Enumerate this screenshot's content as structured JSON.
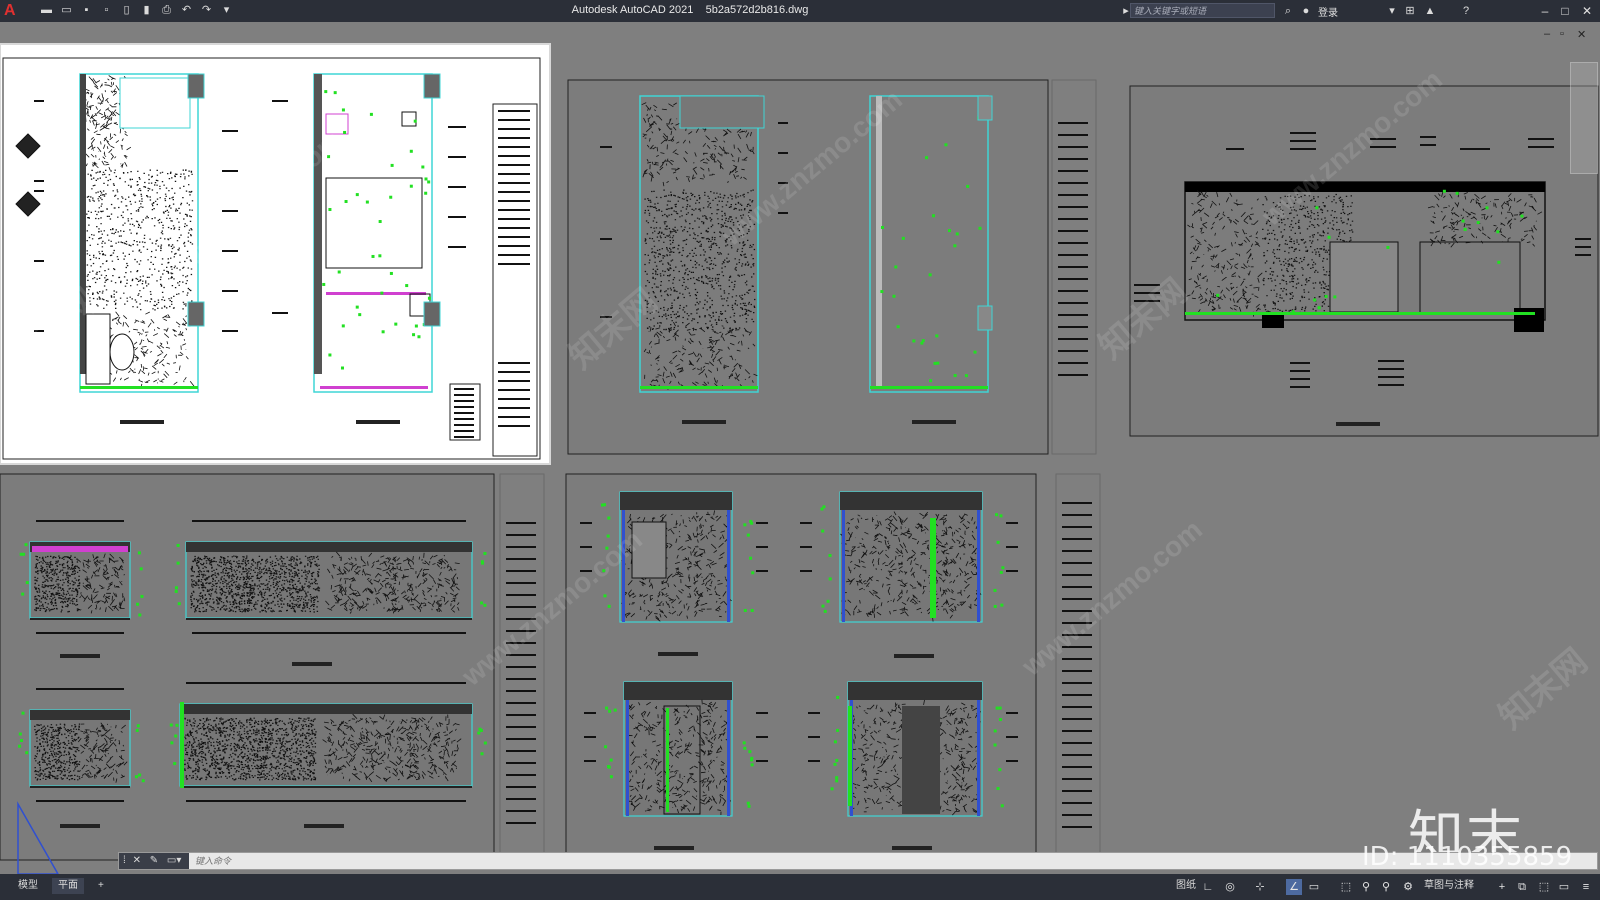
{
  "titlebar": {
    "app_name": "Autodesk AutoCAD 2021",
    "file_name": "5b2a572d2b816.dwg",
    "search_placeholder": "键入关键字或短语",
    "login_label": "登录",
    "app_logo": "A"
  },
  "quick_access": [
    {
      "icon": "new-icon",
      "glyph": "▬"
    },
    {
      "icon": "open-icon",
      "glyph": "▭"
    },
    {
      "icon": "save-icon",
      "glyph": "▪"
    },
    {
      "icon": "save-as-icon",
      "glyph": "▫"
    },
    {
      "icon": "open-web-icon",
      "glyph": "▯"
    },
    {
      "icon": "save-web-icon",
      "glyph": "▮"
    },
    {
      "icon": "print-icon",
      "glyph": "⎙"
    },
    {
      "icon": "undo-icon",
      "glyph": "↶"
    },
    {
      "icon": "redo-icon",
      "glyph": "↷"
    },
    {
      "icon": "customize-icon",
      "glyph": "▾"
    }
  ],
  "command_line": {
    "placeholder": "键入命令"
  },
  "layout_tabs": [
    "模型",
    "平面"
  ],
  "status": {
    "paper_label": "图纸",
    "workspace_label": "草图与注释"
  },
  "watermark": {
    "brand_cn": "知末",
    "id_text": "ID: 1110355859",
    "site_text": "www.znzmo.com",
    "site_text_cn": "知末网"
  },
  "colors": {
    "canvas": "#7f7f7f",
    "accent_green": "#22e022",
    "accent_cyan": "#3fd5d5",
    "accent_magenta": "#d040d0",
    "titlebar": "#2b2f38"
  }
}
